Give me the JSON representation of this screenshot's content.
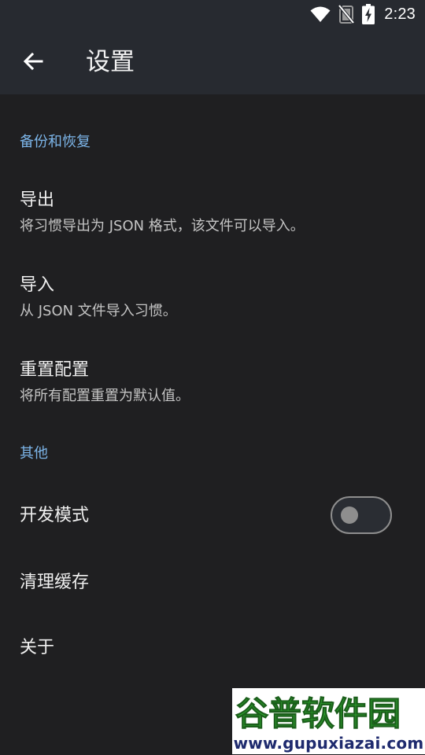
{
  "status_bar": {
    "time": "2:23",
    "icons": [
      "wifi-icon",
      "no-sim-icon",
      "battery-charging-icon"
    ]
  },
  "app_bar": {
    "back_icon": "arrow-left-icon",
    "title": "设置"
  },
  "sections": {
    "backup": {
      "header": "备份和恢复",
      "items": {
        "export": {
          "title": "导出",
          "summary": "将习惯导出为 JSON 格式，该文件可以导入。"
        },
        "import": {
          "title": "导入",
          "summary": "从 JSON 文件导入习惯。"
        },
        "reset": {
          "title": "重置配置",
          "summary": "将所有配置重置为默认值。"
        }
      }
    },
    "other": {
      "header": "其他",
      "items": {
        "dev_mode": {
          "title": "开发模式",
          "enabled": false
        },
        "clear_cache": {
          "title": "清理缓存"
        },
        "about": {
          "title": "关于"
        }
      }
    }
  },
  "watermark": {
    "logo_text": "谷普软件园",
    "url": "www.gupuxiazai.com"
  },
  "colors": {
    "background": "#1f1f21",
    "app_bar": "#272a30",
    "accent": "#7db6ea",
    "toggle_off": "#8e8e8e",
    "watermark_green": "#2ea82e"
  }
}
